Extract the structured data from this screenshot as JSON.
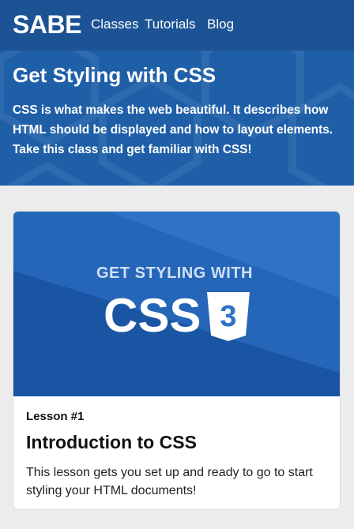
{
  "nav": {
    "logo": "SABE",
    "links": [
      "Classes",
      "Tutorials",
      "Blog"
    ]
  },
  "hero": {
    "title": "Get Styling with CSS",
    "description": "CSS is what makes the web beautiful. It describes how HTML should be displayed and how to layout elements. Take this class and get familiar with CSS!"
  },
  "lesson_card": {
    "image": {
      "tagline": "GET STYLING WITH",
      "big_text": "CSS",
      "badge_number": "3",
      "icon": "css3-shield-icon"
    },
    "kicker": "Lesson #1",
    "title": "Introduction to CSS",
    "description": "This lesson gets you set up and ready to go to start styling your HTML documents!"
  },
  "colors": {
    "hero_bg": "#1f5fa8",
    "navbar_bg": "#1b5394",
    "page_bg": "#ececec",
    "card_bg": "#ffffff",
    "image_light": "#2f73c6",
    "image_dark": "#1a55a3"
  }
}
